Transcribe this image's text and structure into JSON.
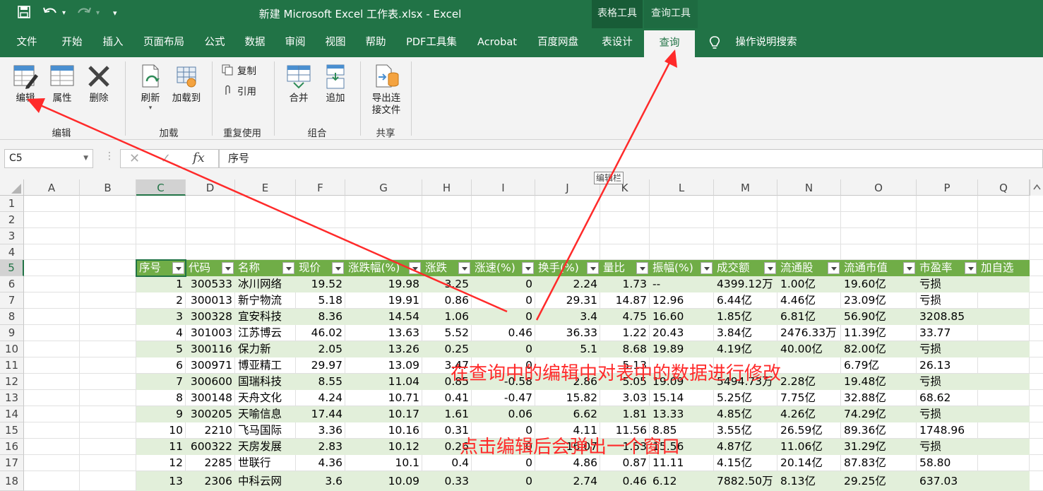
{
  "window": {
    "title": "新建 Microsoft Excel 工作表.xlsx  -  Excel",
    "context_tabs": [
      "表格工具",
      "查询工具"
    ]
  },
  "ribbon_tabs": [
    "文件",
    "开始",
    "插入",
    "页面布局",
    "公式",
    "数据",
    "审阅",
    "视图",
    "帮助",
    "PDF工具集",
    "Acrobat",
    "百度网盘",
    "表设计",
    "查询"
  ],
  "active_tab": "查询",
  "tell_me": "操作说明搜索",
  "ribbon": {
    "edit_group": {
      "label": "编辑",
      "edit": "编辑",
      "properties": "属性",
      "delete": "删除"
    },
    "load_group": {
      "label": "加载",
      "refresh": "刷新",
      "load_to": "加载到"
    },
    "reuse_group": {
      "label": "重复使用",
      "duplicate": "复制",
      "reference": "引用"
    },
    "combine_group": {
      "label": "组合",
      "merge": "合并",
      "append": "追加"
    },
    "share_group": {
      "label": "共享",
      "export_line1": "导出连",
      "export_line2": "接文件"
    }
  },
  "formula_bar": {
    "name_box": "C5",
    "content": "序号",
    "tooltip": "编辑栏"
  },
  "columns": [
    "A",
    "B",
    "C",
    "D",
    "E",
    "F",
    "G",
    "H",
    "I",
    "J",
    "K",
    "L",
    "M",
    "N",
    "O",
    "P",
    "Q"
  ],
  "rows": [
    "1",
    "2",
    "3",
    "4",
    "5",
    "6",
    "7",
    "8",
    "9",
    "10",
    "11",
    "12",
    "13",
    "14",
    "15",
    "16",
    "17",
    "18"
  ],
  "table": {
    "headers": [
      "序号",
      "代码",
      "名称",
      "现价",
      "涨跌幅(%)",
      "涨跌",
      "涨速(%)",
      "换手(%)",
      "量比",
      "振幅(%)",
      "成交额",
      "流通股",
      "流通市值",
      "市盈率",
      "加自选"
    ],
    "rows": [
      [
        "1",
        "300533",
        "冰川网络",
        "19.52",
        "19.98",
        "3.25",
        "0",
        "2.24",
        "1.73",
        "--",
        "4399.12万",
        "1.00亿",
        "19.60亿",
        "亏损",
        ""
      ],
      [
        "2",
        "300013",
        "新宁物流",
        "5.18",
        "19.91",
        "0.86",
        "0",
        "29.31",
        "14.87",
        "12.96",
        "6.44亿",
        "4.46亿",
        "23.09亿",
        "亏损",
        ""
      ],
      [
        "3",
        "300328",
        "宜安科技",
        "8.36",
        "14.54",
        "1.06",
        "0",
        "3.4",
        "4.75",
        "16.60",
        "1.85亿",
        "6.81亿",
        "56.90亿",
        "3208.85",
        ""
      ],
      [
        "4",
        "301003",
        "江苏博云",
        "46.02",
        "13.63",
        "5.52",
        "0.46",
        "36.33",
        "1.22",
        "20.43",
        "3.84亿",
        "2476.33万",
        "11.39亿",
        "33.77",
        ""
      ],
      [
        "5",
        "300116",
        "保力新",
        "2.05",
        "13.26",
        "0.25",
        "0",
        "5.1",
        "8.68",
        "19.89",
        "4.19亿",
        "40.00亿",
        "82.00亿",
        "亏损",
        ""
      ],
      [
        "6",
        "300971",
        "博亚精工",
        "29.97",
        "13.09",
        "3.47",
        "0",
        "",
        "5.13",
        "",
        "",
        "",
        "6.79亿",
        "26.13",
        ""
      ],
      [
        "7",
        "300600",
        "国瑞科技",
        "8.55",
        "11.04",
        "0.85",
        "-0.58",
        "2.86",
        "5.05",
        "19.09",
        "5494.73万",
        "2.28亿",
        "19.48亿",
        "亏损",
        ""
      ],
      [
        "8",
        "300148",
        "天舟文化",
        "4.24",
        "10.71",
        "0.41",
        "-0.47",
        "15.82",
        "3.03",
        "15.14",
        "5.25亿",
        "7.75亿",
        "32.88亿",
        "68.62",
        ""
      ],
      [
        "9",
        "300205",
        "天喻信息",
        "17.44",
        "10.17",
        "1.61",
        "0.06",
        "6.62",
        "1.81",
        "13.33",
        "4.85亿",
        "4.26亿",
        "74.29亿",
        "亏损",
        ""
      ],
      [
        "10",
        "2210",
        "飞马国际",
        "3.36",
        "10.16",
        "0.31",
        "0",
        "4.11",
        "11.56",
        "8.85",
        "3.55亿",
        "26.59亿",
        "89.36亿",
        "1748.96",
        ""
      ],
      [
        "11",
        "600322",
        "天房发展",
        "2.83",
        "10.12",
        "0.26",
        "0",
        "16.07",
        "1.53",
        "15.56",
        "4.87亿",
        "11.06亿",
        "31.29亿",
        "亏损",
        ""
      ],
      [
        "12",
        "2285",
        "世联行",
        "4.36",
        "10.1",
        "0.4",
        "0",
        "4.86",
        "0.87",
        "11.11",
        "4.15亿",
        "20.14亿",
        "87.83亿",
        "58.80",
        ""
      ],
      [
        "13",
        "2306",
        "中科云网",
        "3.6",
        "10.09",
        "0.33",
        "0",
        "2.74",
        "0.46",
        "6.12",
        "7882.50万",
        "8.13亿",
        "29.25亿",
        "637.03",
        ""
      ]
    ]
  },
  "annotations": {
    "line1": "在查询中的编辑中对表中的数据进行修改",
    "line2": "点击编辑后会弹出一个窗口"
  },
  "colors": {
    "excel_green": "#217346",
    "table_header": "#70ad47",
    "band": "#e2efda",
    "annotation": "#ff2a2a"
  }
}
